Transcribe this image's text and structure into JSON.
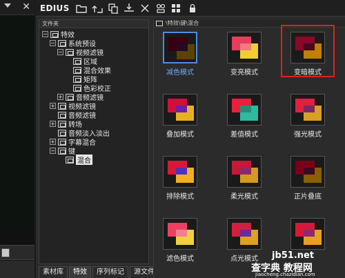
{
  "app": {
    "brand": "EDIUS"
  },
  "toolbar": {
    "icons": [
      "folder-icon",
      "up-folder-icon",
      "copy-icon",
      "import-icon",
      "cut-icon",
      "settings-icon",
      "view-icon",
      "lock-icon"
    ]
  },
  "folder_panel": {
    "header": "文件夹",
    "tree": [
      {
        "label": "特效",
        "level": 0,
        "expander": "−",
        "icon": "folder-open"
      },
      {
        "label": "系统预设",
        "level": 1,
        "expander": "−",
        "icon": "folder-open"
      },
      {
        "label": "视频滤镜",
        "level": 2,
        "expander": "−",
        "icon": "folder-open"
      },
      {
        "label": "区域",
        "level": 3,
        "expander": "",
        "icon": "folder"
      },
      {
        "label": "混合效果",
        "level": 3,
        "expander": "",
        "icon": "folder"
      },
      {
        "label": "矩阵",
        "level": 3,
        "expander": "",
        "icon": "folder"
      },
      {
        "label": "色彩校正",
        "level": 3,
        "expander": "",
        "icon": "folder"
      },
      {
        "label": "音频滤镜",
        "level": 2,
        "expander": "+",
        "icon": "folder"
      },
      {
        "label": "视频滤镜",
        "level": 1,
        "expander": "+",
        "icon": "folder"
      },
      {
        "label": "音频滤镜",
        "level": 1,
        "expander": "",
        "icon": "folder"
      },
      {
        "label": "转场",
        "level": 1,
        "expander": "+",
        "icon": "folder"
      },
      {
        "label": "音频淡入淡出",
        "level": 1,
        "expander": "",
        "icon": "folder"
      },
      {
        "label": "字幕混合",
        "level": 1,
        "expander": "+",
        "icon": "folder"
      },
      {
        "label": "键",
        "level": 1,
        "expander": "−",
        "icon": "folder"
      },
      {
        "label": "混合",
        "level": 2,
        "expander": "",
        "icon": "folder",
        "selected": true
      }
    ]
  },
  "tabs": [
    {
      "label": "素材库",
      "active": false
    },
    {
      "label": "特效",
      "active": true
    },
    {
      "label": "序列标记",
      "active": false
    },
    {
      "label": "源文件浏览",
      "active": false
    }
  ],
  "grid": {
    "path": "\\特效\\键\\混合",
    "items": [
      {
        "label": "减色模式",
        "selected": true,
        "colors": [
          "#3a0010",
          "#5a4400",
          "#220a2a"
        ]
      },
      {
        "label": "变亮模式",
        "selected": false,
        "colors": [
          "#e83c5c",
          "#f2cc33",
          "#f07a80"
        ]
      },
      {
        "label": "变暗模式",
        "selected": false,
        "colors": [
          "#8a0828",
          "#c08000",
          "#4a0820"
        ],
        "highlighted": true
      },
      {
        "label": "叠加模式",
        "selected": false,
        "colors": [
          "#d0103a",
          "#e6b020",
          "#6a20a8"
        ]
      },
      {
        "label": "差值模式",
        "selected": false,
        "colors": [
          "#e8203c",
          "#30b8a0",
          "#2a8a78"
        ]
      },
      {
        "label": "强光模式",
        "selected": false,
        "colors": [
          "#e02040",
          "#d8a020",
          "#7a2a60"
        ]
      },
      {
        "label": "排除模式",
        "selected": false,
        "colors": [
          "#d81838",
          "#f0b020",
          "#5030c0"
        ]
      },
      {
        "label": "柔光模式",
        "selected": false,
        "colors": [
          "#c81838",
          "#d49a20",
          "#8a2a6a"
        ]
      },
      {
        "label": "正片叠底",
        "selected": false,
        "colors": [
          "#7a0018",
          "#8a6000",
          "#3a0a20"
        ]
      },
      {
        "label": "滤色模式",
        "selected": false,
        "colors": [
          "#ec4060",
          "#f4d040",
          "#f08090"
        ]
      },
      {
        "label": "点光模式",
        "selected": false,
        "colors": [
          "#d02040",
          "#e0a020",
          "#6a2aa0"
        ]
      },
      {
        "label": "",
        "selected": false,
        "colors": [
          "#d81838",
          "#e8a020",
          "#8a2a7a"
        ]
      }
    ]
  },
  "watermark": {
    "site": "jb51.net",
    "text": "查字典 教程网",
    "sub": "jiaocheng.chazidian.com"
  }
}
